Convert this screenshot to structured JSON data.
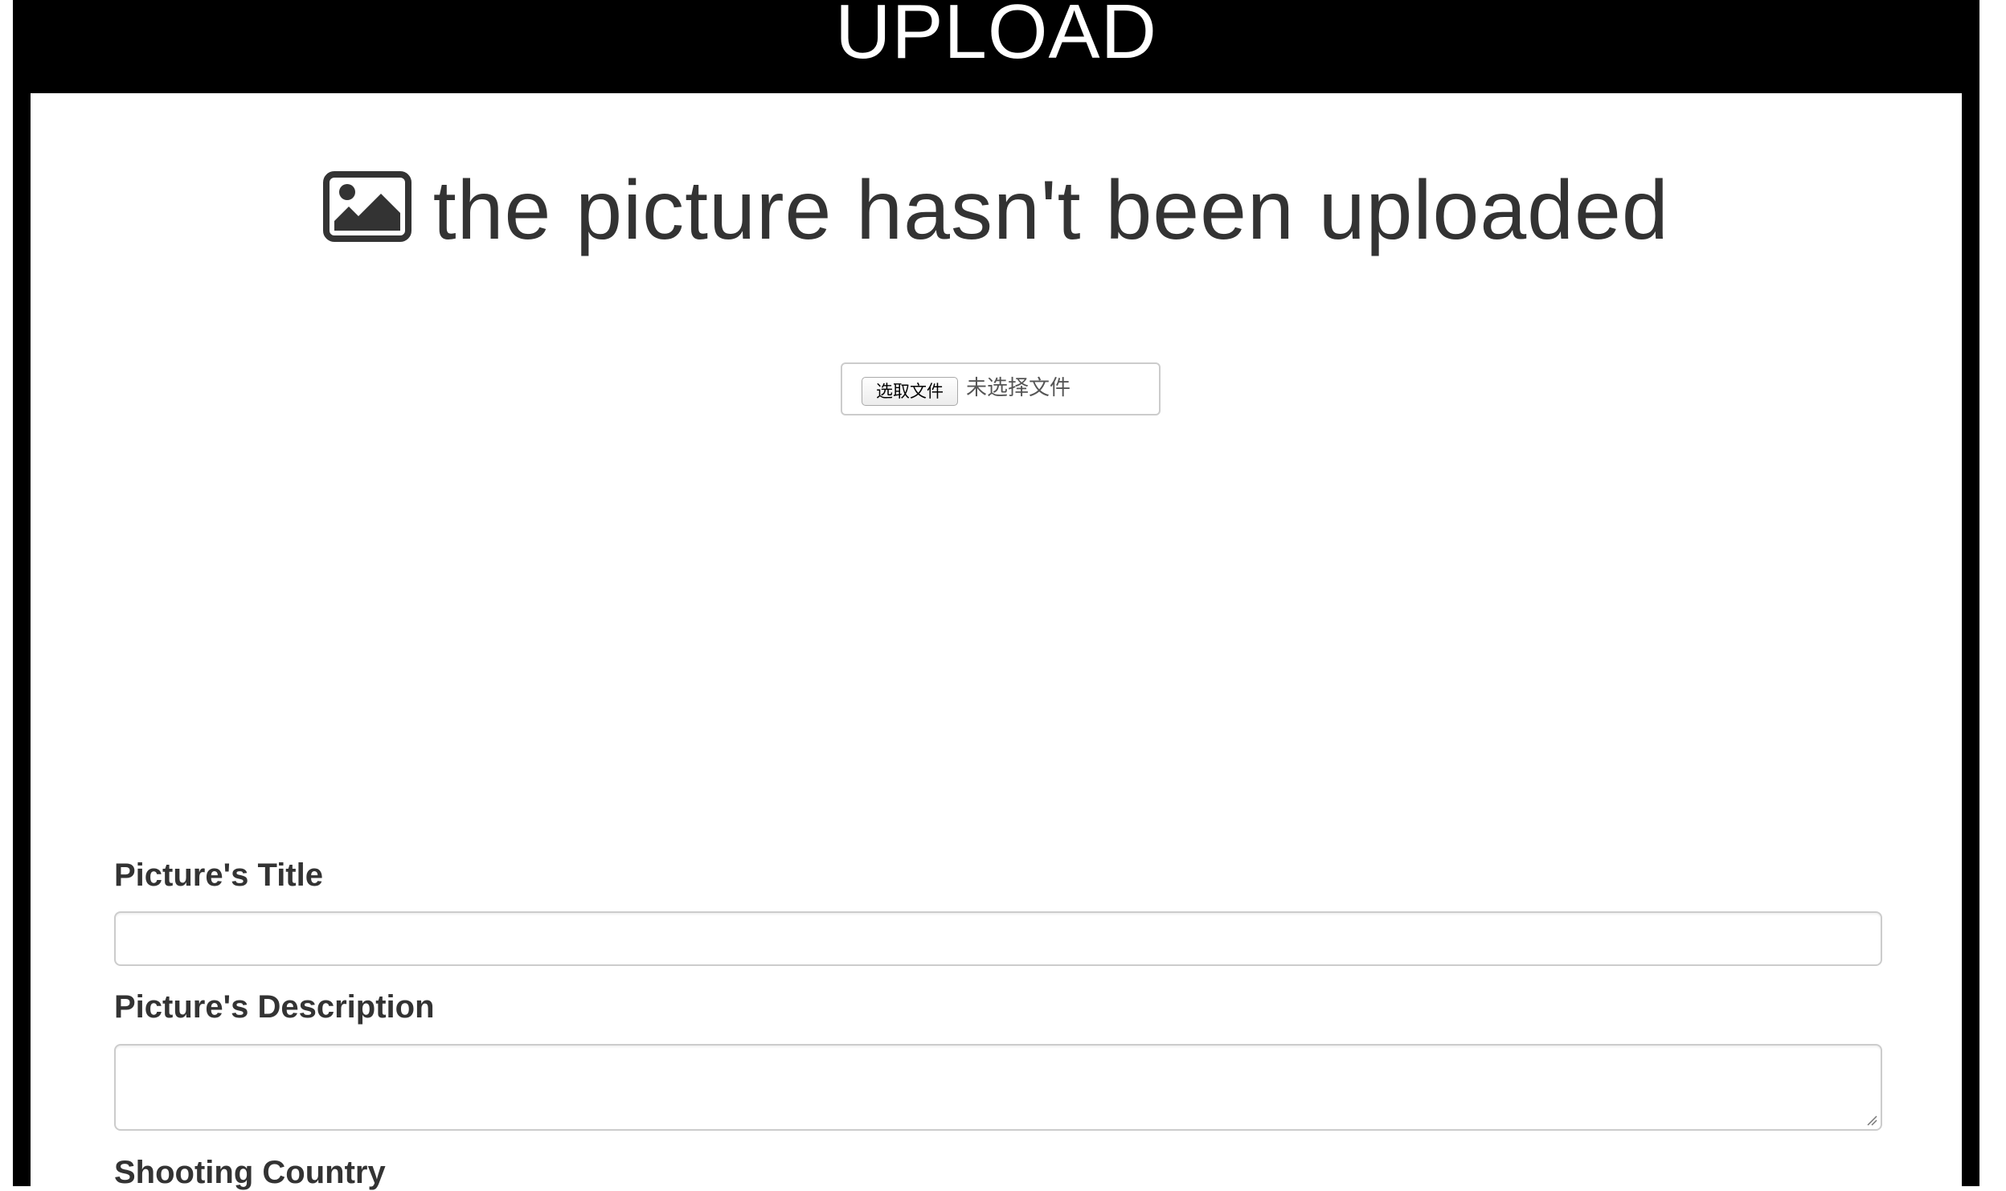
{
  "header": {
    "title": "UPLOAD"
  },
  "upload_status": {
    "icon": "image-icon",
    "message": "the picture hasn't been uploaded"
  },
  "file_input": {
    "button_label": "选取文件",
    "status_text": "未选择文件"
  },
  "form": {
    "title_label": "Picture's Title",
    "title_value": "",
    "description_label": "Picture's Description",
    "description_value": "",
    "country_label": "Shooting Country"
  },
  "colors": {
    "header_background": "#000000",
    "header_text": "#ffffff",
    "body_text": "#333333",
    "input_border": "#cccccc"
  }
}
